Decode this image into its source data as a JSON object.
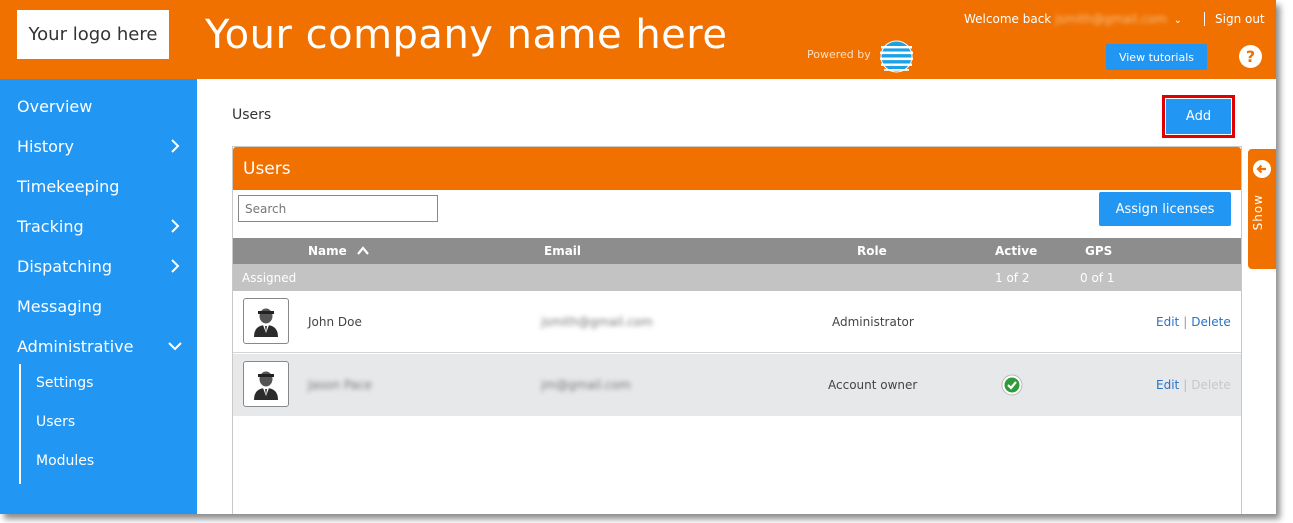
{
  "header": {
    "logo_text": "Your logo here",
    "company_name": "Your company name here",
    "powered_by": "Powered by",
    "welcome_prefix": "Welcome back",
    "welcome_user": "jsmith@gmail.com",
    "sign_out": "Sign out",
    "view_tutorials": "View tutorials",
    "help": "?"
  },
  "sidebar": {
    "items": [
      {
        "label": "Overview",
        "arrow": ""
      },
      {
        "label": "History",
        "arrow": "chevron-right-icon"
      },
      {
        "label": "Timekeeping",
        "arrow": ""
      },
      {
        "label": "Tracking",
        "arrow": "chevron-right-icon"
      },
      {
        "label": "Dispatching",
        "arrow": "chevron-right-icon"
      },
      {
        "label": "Messaging",
        "arrow": ""
      },
      {
        "label": "Administrative",
        "arrow": "chevron-down-icon"
      }
    ],
    "sub_items": [
      "Settings",
      "Users",
      "Modules"
    ]
  },
  "page": {
    "breadcrumb": "Users",
    "add_button": "Add"
  },
  "panel": {
    "title": "Users",
    "search_placeholder": "Search",
    "assign_button": "Assign licenses",
    "columns": {
      "name": "Name",
      "email": "Email",
      "role": "Role",
      "active": "Active",
      "gps": "GPS"
    },
    "assigned": {
      "label": "Assigned",
      "active": "1 of 2",
      "gps": "0 of 1"
    },
    "rows": [
      {
        "name": "John Doe",
        "email": "jsmith@gmail.com",
        "role": "Administrator",
        "active": false,
        "edit": "Edit",
        "sep": "|",
        "delete": "Delete"
      },
      {
        "name": "Jason Pace",
        "email": "jm@gmail.com",
        "role": "Account owner",
        "active": true,
        "edit": "Edit",
        "sep": "|",
        "delete": "Delete"
      }
    ]
  },
  "show_tab": {
    "label": "Show"
  },
  "colors": {
    "orange": "#f07100",
    "blue": "#2196f3",
    "highlight": "#e00000"
  }
}
